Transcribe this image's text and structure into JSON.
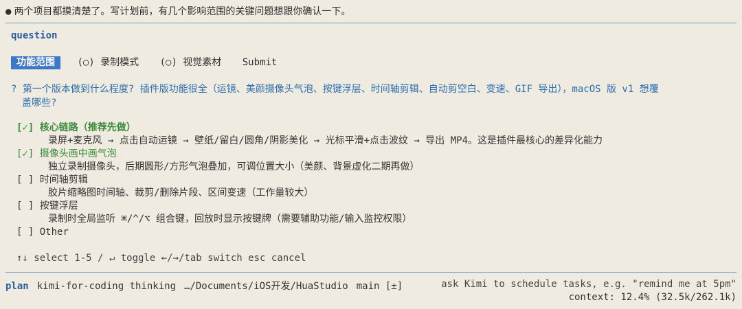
{
  "header": {
    "bullet": "●",
    "message": "两个项目都摸清楚了。写计划前，有几个影响范围的关键问题想跟你确认一下。"
  },
  "question_panel": {
    "title": "question",
    "tabs": [
      {
        "label": "功能范围",
        "active": true
      },
      {
        "label": "(○) 录制模式",
        "active": false
      },
      {
        "label": "(○) 视觉素材",
        "active": false
      },
      {
        "label": "Submit",
        "active": false
      }
    ],
    "question_line1": "? 第一个版本做到什么程度? 插件版功能很全（运镜、美颜摄像头气泡、按键浮层、时间轴剪辑、自动剪空白、变速、GIF 导出），macOS 版 v1 想覆",
    "question_line2": "盖哪些?",
    "options": [
      {
        "checkbox": "[✓]",
        "label": "核心链路（推荐先做）",
        "desc": "录屏+麦克风 → 点击自动运镜 → 壁纸/留白/圆角/阴影美化 → 光标平滑+点击波纹 → 导出 MP4。这是插件最核心的差异化能力",
        "checked": true
      },
      {
        "checkbox": "[✓]",
        "label": "摄像头画中画气泡",
        "desc": "独立录制摄像头，后期圆形/方形气泡叠加，可调位置大小（美颜、背景虚化二期再做）",
        "checked": true
      },
      {
        "checkbox": "[ ]",
        "label": "时间轴剪辑",
        "desc": "胶片缩略图时间轴、裁剪/删除片段、区间变速（工作量较大）",
        "checked": false
      },
      {
        "checkbox": "[ ]",
        "label": "按键浮层",
        "desc": "录制时全局监听 ⌘/^/⌥ 组合键，回放时显示按键牌（需要辅助功能/输入监控权限）",
        "checked": false
      },
      {
        "checkbox": "[ ]",
        "label": "Other",
        "desc": "",
        "checked": false
      }
    ],
    "hints": "↑↓ select  1-5 / ↵ toggle  ←/→/tab switch  esc cancel"
  },
  "status_bar": {
    "mode": "plan",
    "model": "kimi-for-coding thinking",
    "path": "…/Documents/iOS开发/HuaStudio",
    "branch": "main [±]",
    "tip": "ask Kimi to schedule tasks, e.g. \"remind me at 5pm\"",
    "context": "context: 12.4% (32.5k/262.1k)"
  }
}
